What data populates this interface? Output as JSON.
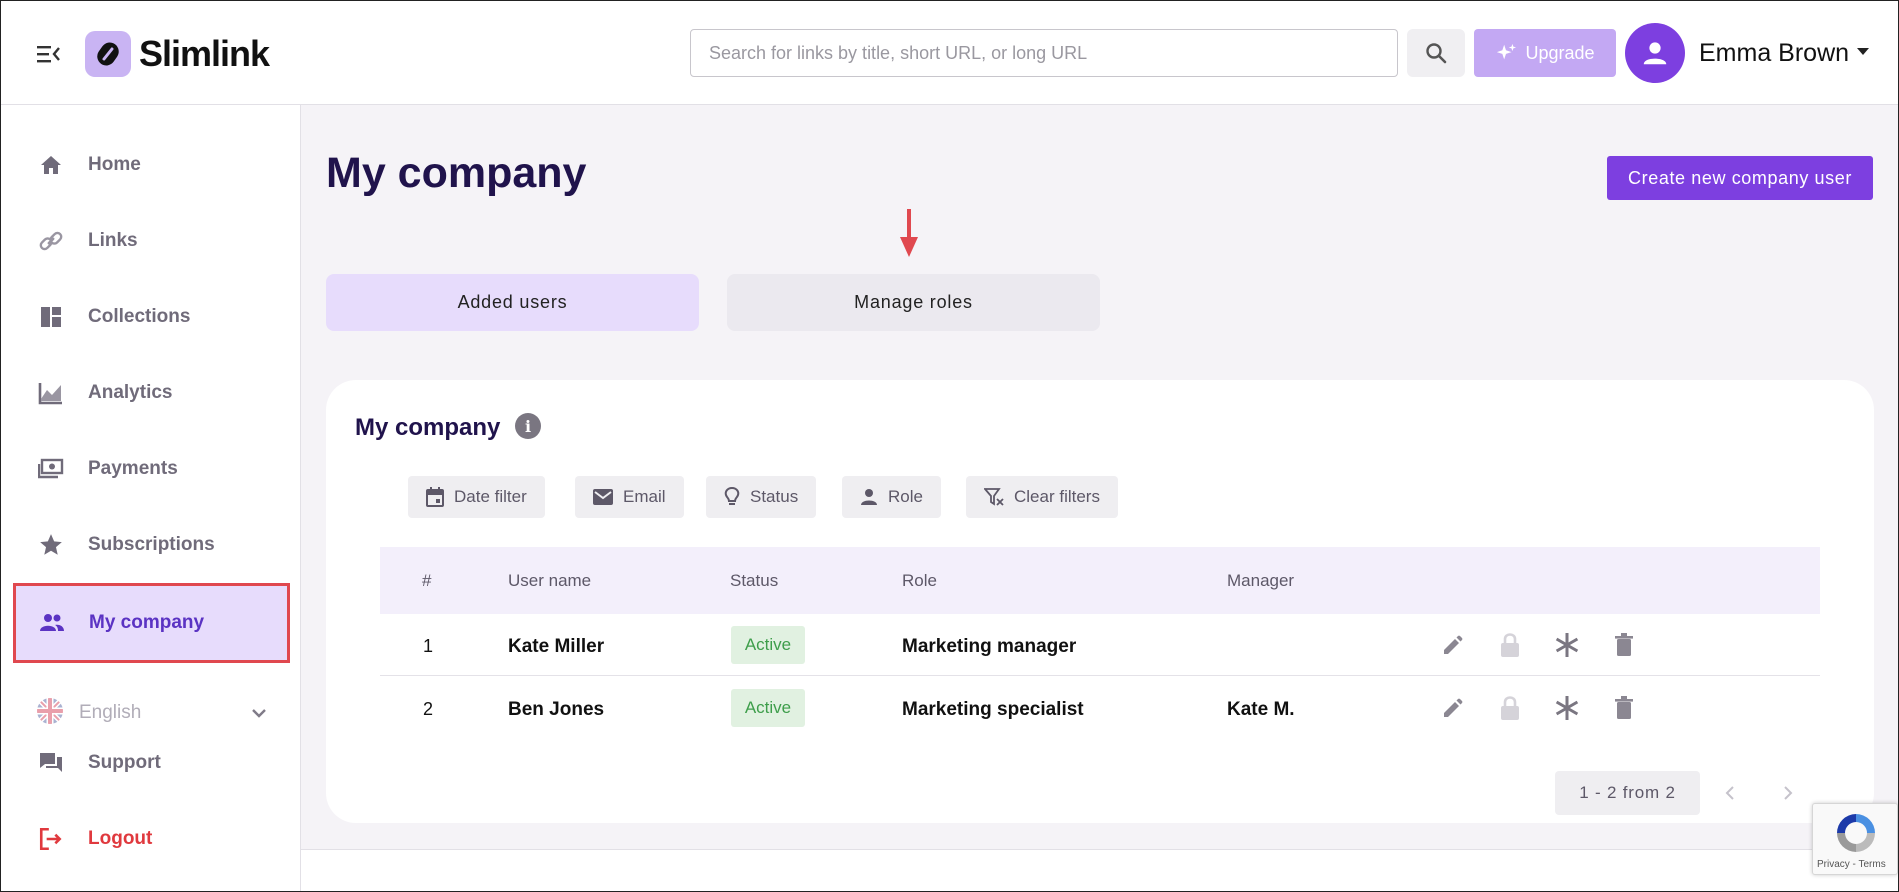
{
  "app": {
    "name": "Slimlink"
  },
  "header": {
    "search_placeholder": "Search for links by title, short URL, or long URL",
    "upgrade_label": "Upgrade",
    "user_name": "Emma Brown"
  },
  "sidebar": {
    "items": [
      {
        "label": "Home",
        "icon": "home-icon"
      },
      {
        "label": "Links",
        "icon": "link-icon"
      },
      {
        "label": "Collections",
        "icon": "collections-icon"
      },
      {
        "label": "Analytics",
        "icon": "analytics-icon"
      },
      {
        "label": "Payments",
        "icon": "payments-icon"
      },
      {
        "label": "Subscriptions",
        "icon": "star-icon"
      },
      {
        "label": "My company",
        "icon": "people-icon",
        "active": true
      }
    ],
    "language": "English",
    "support": "Support",
    "logout": "Logout"
  },
  "main": {
    "title": "My company",
    "create_button": "Create new company user",
    "tabs": [
      {
        "label": "Added users",
        "active": true
      },
      {
        "label": "Manage roles",
        "active": false
      }
    ],
    "card": {
      "title": "My company",
      "filters": [
        "Date filter",
        "Email",
        "Status",
        "Role",
        "Clear filters"
      ],
      "columns": [
        "#",
        "User name",
        "Status",
        "Role",
        "Manager"
      ],
      "rows": [
        {
          "num": "1",
          "user_name": "Kate Miller",
          "status": "Active",
          "role": "Marketing manager",
          "manager": ""
        },
        {
          "num": "2",
          "user_name": "Ben Jones",
          "status": "Active",
          "role": "Marketing specialist",
          "manager": "Kate M."
        }
      ],
      "pagination": "1 - 2 from 2"
    }
  },
  "recaptcha": {
    "text": "Privacy - Terms"
  },
  "colors": {
    "accent": "#7d3fe0",
    "accent_light": "#e7dcfc",
    "active_text": "#5b33c3",
    "status_green": "#3e9e4b",
    "logout_red": "#e0393e",
    "highlight_red": "#e0484f"
  }
}
